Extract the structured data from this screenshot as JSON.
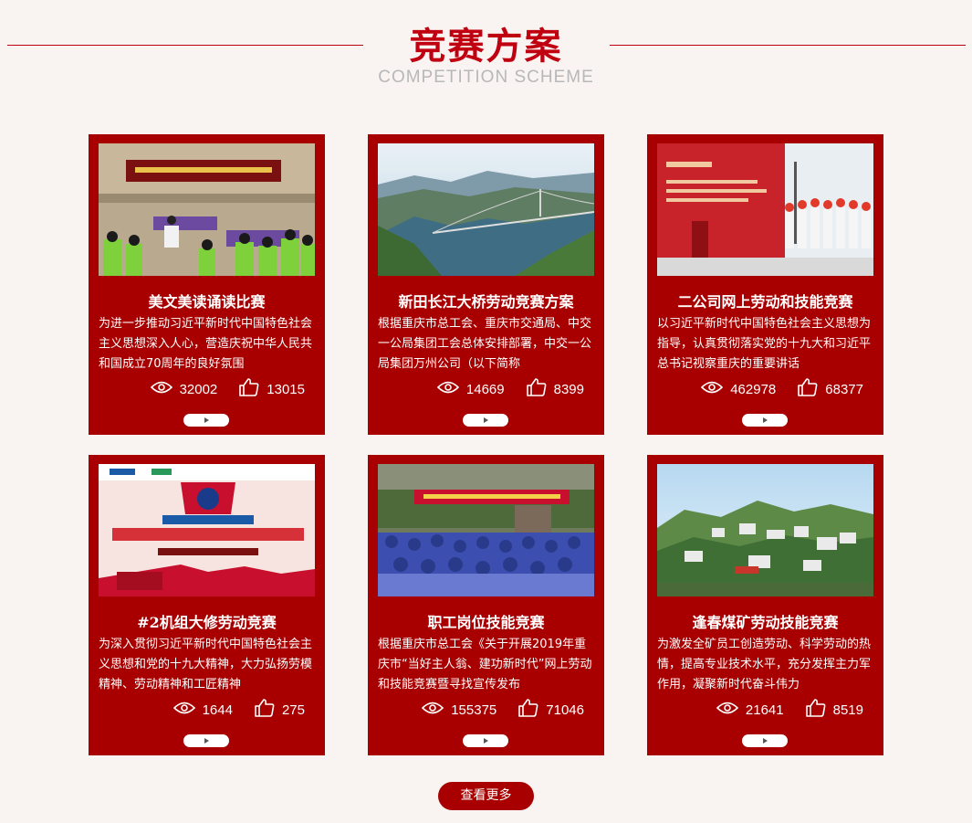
{
  "header": {
    "title": "竞赛方案",
    "subtitle": "COMPETITION SCHEME"
  },
  "cards": [
    {
      "title": "美文美读诵读比赛",
      "desc": "为进一步推动习近平新时代中国特色社会主义思想深入人心，营造庆祝中华人民共和国成立70周年的良好氛围",
      "views": "32002",
      "likes": "13015",
      "image": "classroom-photo"
    },
    {
      "title": "新田长江大桥劳动竞赛方案",
      "desc": "根据重庆市总工会、重庆市交通局、中交一公局集团工会总体安排部署，中交一公局集团万州公司（以下简称",
      "views": "14669",
      "likes": "8399",
      "image": "bridge-photo"
    },
    {
      "title": "二公司网上劳动和技能竞赛",
      "desc": "以习近平新时代中国特色社会主义思想为指导，认真贯彻落实党的十九大和习近平总书记视察重庆的重要讲话",
      "views": "462978",
      "likes": "68377",
      "image": "ceremony-photo"
    },
    {
      "title": "#2机组大修劳动竞赛",
      "desc": "为深入贯彻习近平新时代中国特色社会主义思想和党的十九大精神，大力弘扬劳模精神、劳动精神和工匠精神",
      "views": "1644",
      "likes": "275",
      "image": "poster-image"
    },
    {
      "title": "职工岗位技能竞赛",
      "desc": "根据重庆市总工会《关于开展2019年重庆市“当好主人翁、建功新时代”网上劳动和技能竞赛暨寻找宣传发布",
      "views": "155375",
      "likes": "71046",
      "image": "crowd-photo"
    },
    {
      "title": "逢春煤矿劳动技能竞赛",
      "desc": "为激发全矿员工创造劳动、科学劳动的热情，提高专业技术水平，充分发挥主力军作用，凝聚新时代奋斗伟力",
      "views": "21641",
      "likes": "8519",
      "image": "mountain-town-photo"
    }
  ],
  "more_button": "查看更多",
  "colors": {
    "accent": "#a80000",
    "title_red": "#c00011",
    "background": "#f9f3f1"
  }
}
